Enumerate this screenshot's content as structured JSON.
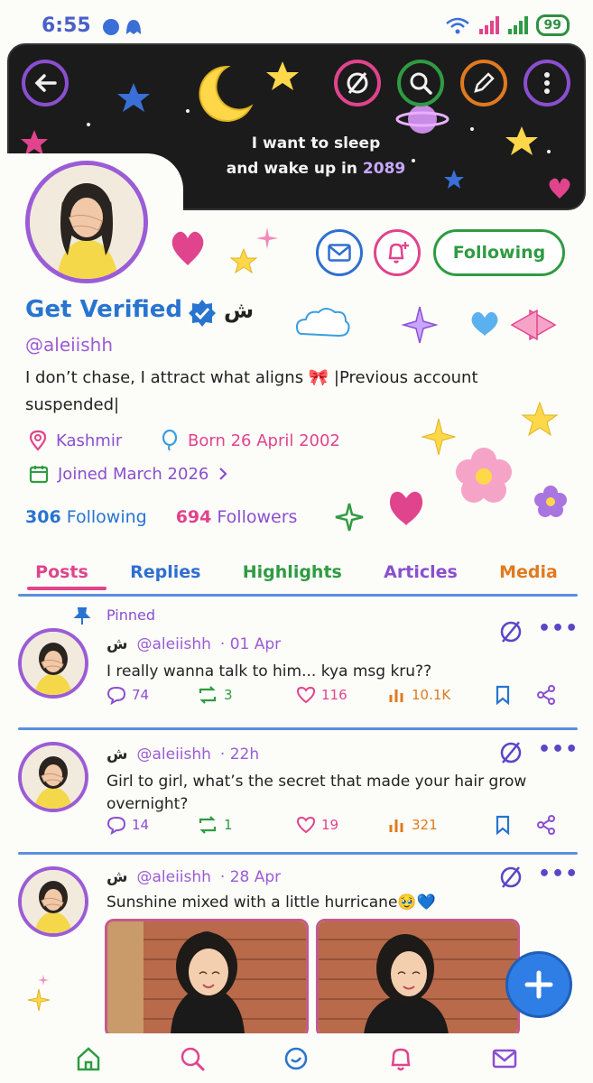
{
  "status_bar": {
    "time": "6:55",
    "battery": "99"
  },
  "banner": {
    "line1": "I want to sleep",
    "line2_prefix": "and wake up in ",
    "line2_accent": "2089"
  },
  "header_buttons": {
    "back": "back-arrow-icon",
    "grok": "grok-icon",
    "search": "search-icon",
    "edit": "pencil-icon",
    "more": "more-vertical-icon"
  },
  "profile": {
    "name": "Get Verified",
    "name_suffix": "ش",
    "handle": "@aleiishh",
    "bio": "I don’t chase, I attract what aligns 🎀 |Previous account suspended|",
    "location": "Kashmir",
    "birthday": "Born 26 April 2002",
    "joined": "Joined March 2026",
    "following_count": "306",
    "following_label": "Following",
    "followers_count": "694",
    "followers_label": "Followers",
    "follow_button": "Following"
  },
  "tabs": [
    {
      "label": "Posts",
      "color": "#e0448c"
    },
    {
      "label": "Replies",
      "color": "#2f6fd0"
    },
    {
      "label": "Highlights",
      "color": "#2f9b43"
    },
    {
      "label": "Articles",
      "color": "#8a4fd0"
    },
    {
      "label": "Media",
      "color": "#e07a1f"
    }
  ],
  "posts": [
    {
      "pinned_label": "Pinned",
      "author": "ش",
      "handle": "@aleiishh",
      "time": "· 01 Apr",
      "text": "I really wanna talk to him... kya msg kru??",
      "replies": "74",
      "reposts": "3",
      "likes": "116",
      "views": "10.1K"
    },
    {
      "author": "ش",
      "handle": "@aleiishh",
      "time": "· 22h",
      "text": "Girl to girl, what’s the secret that made your hair grow overnight?",
      "replies": "14",
      "reposts": "1",
      "likes": "19",
      "views": "321"
    },
    {
      "author": "ش",
      "handle": "@aleiishh",
      "time": "· 28 Apr",
      "text": "Sunshine mixed with a little hurricane🥹💙"
    }
  ],
  "colors": {
    "accent_blue": "#2874d0",
    "accent_purple": "#9b5cd6",
    "accent_pink": "#e0448c",
    "accent_green": "#2f9b43",
    "accent_orange": "#e07a1f"
  },
  "bottom_nav": [
    "home-icon",
    "search-icon",
    "grok-icon",
    "bell-icon",
    "mail-icon"
  ]
}
